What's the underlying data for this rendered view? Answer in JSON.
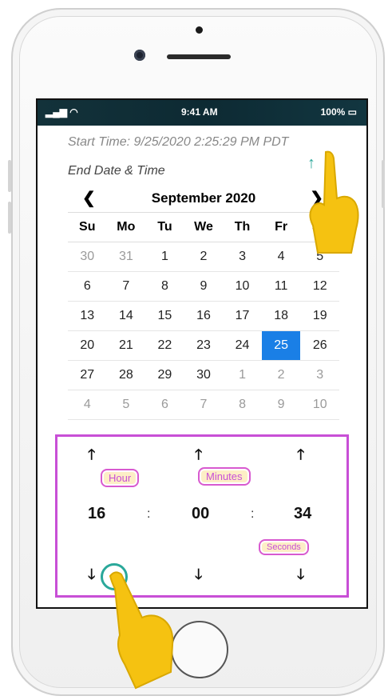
{
  "status_bar": {
    "signal": "▂▄▆ ◠",
    "time": "9:41 AM",
    "battery": "100% ▭"
  },
  "start_time": "Start Time: 9/25/2020 2:25:29 PM PDT",
  "end_label": "End Date & Time",
  "calendar": {
    "prev": "❮",
    "title": "September 2020",
    "next": "❯",
    "dow": [
      "Su",
      "Mo",
      "Tu",
      "We",
      "Th",
      "Fr",
      "Sa"
    ],
    "weeks": [
      [
        {
          "d": "30",
          "m": true
        },
        {
          "d": "31",
          "m": true
        },
        {
          "d": "1"
        },
        {
          "d": "2"
        },
        {
          "d": "3"
        },
        {
          "d": "4"
        },
        {
          "d": "5"
        }
      ],
      [
        {
          "d": "6"
        },
        {
          "d": "7"
        },
        {
          "d": "8"
        },
        {
          "d": "9"
        },
        {
          "d": "10"
        },
        {
          "d": "11"
        },
        {
          "d": "12"
        }
      ],
      [
        {
          "d": "13"
        },
        {
          "d": "14"
        },
        {
          "d": "15"
        },
        {
          "d": "16"
        },
        {
          "d": "17"
        },
        {
          "d": "18"
        },
        {
          "d": "19"
        }
      ],
      [
        {
          "d": "20"
        },
        {
          "d": "21"
        },
        {
          "d": "22"
        },
        {
          "d": "23"
        },
        {
          "d": "24"
        },
        {
          "d": "25",
          "s": true
        },
        {
          "d": "26"
        }
      ],
      [
        {
          "d": "27"
        },
        {
          "d": "28"
        },
        {
          "d": "29"
        },
        {
          "d": "30"
        },
        {
          "d": "1",
          "m": true
        },
        {
          "d": "2",
          "m": true
        },
        {
          "d": "3",
          "m": true
        }
      ],
      [
        {
          "d": "4",
          "m": true
        },
        {
          "d": "5",
          "m": true
        },
        {
          "d": "6",
          "m": true
        },
        {
          "d": "7",
          "m": true
        },
        {
          "d": "8",
          "m": true
        },
        {
          "d": "9",
          "m": true
        },
        {
          "d": "10",
          "m": true
        }
      ]
    ]
  },
  "time_picker": {
    "up": "🡑",
    "down": "🡓",
    "hour": "16",
    "minutes": "00",
    "seconds": "34",
    "colon": ":"
  },
  "callouts": {
    "hour": "Hour",
    "minutes": "Minutes",
    "seconds": "Seconds"
  },
  "icons": {
    "up_arrow": "up-arrow-icon",
    "down_arrow": "down-arrow-icon",
    "pointer_hand": "pointer-hand-icon"
  },
  "colors": {
    "accent": "#c84fd6",
    "selected": "#1a7fe6",
    "teal": "#2aa89a",
    "hand": "#f5c211"
  }
}
